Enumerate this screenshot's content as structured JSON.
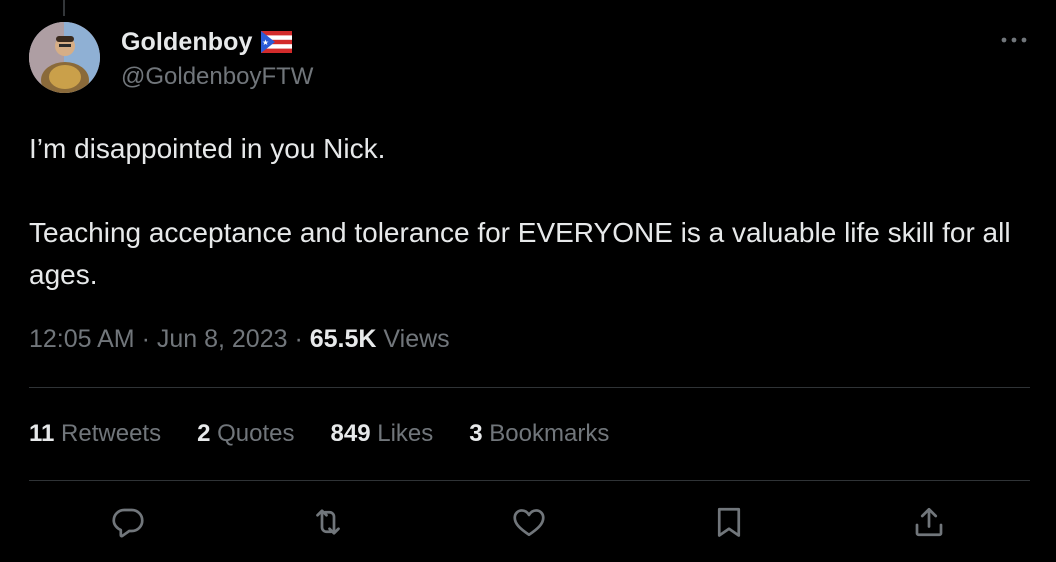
{
  "author": {
    "display_name": "Goldenboy",
    "handle": "@GoldenboyFTW"
  },
  "tweet": {
    "line1": "I’m disappointed in you Nick.",
    "line2": "Teaching acceptance and tolerance for EVERYONE is a valuable life skill for all ages."
  },
  "meta": {
    "time": "12:05 AM",
    "separator1": " · ",
    "date": "Jun 8, 2023",
    "separator2": " · ",
    "views_count": "65.5K",
    "views_label": " Views"
  },
  "stats": [
    {
      "count": "11",
      "label": " Retweets"
    },
    {
      "count": "2",
      "label": " Quotes"
    },
    {
      "count": "849",
      "label": " Likes"
    },
    {
      "count": "3",
      "label": " Bookmarks"
    }
  ],
  "icons": {
    "flag": "puerto-rico-flag-icon",
    "more": "more-icon",
    "reply": "reply-icon",
    "retweet": "retweet-icon",
    "like": "heart-icon",
    "bookmark": "bookmark-icon",
    "share": "share-icon"
  },
  "colors": {
    "background": "#000000",
    "text_primary": "#e7e9ea",
    "text_secondary": "#71767b",
    "divider": "#2f3336"
  }
}
